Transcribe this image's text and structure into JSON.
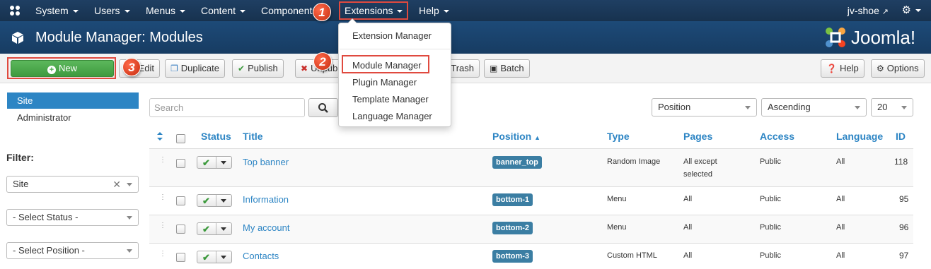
{
  "navbar": {
    "items": [
      {
        "label": "System"
      },
      {
        "label": "Users"
      },
      {
        "label": "Menus"
      },
      {
        "label": "Content"
      },
      {
        "label": "Components"
      },
      {
        "label": "Extensions"
      },
      {
        "label": "Help"
      }
    ],
    "user": "jv-shoe"
  },
  "extensions_menu": {
    "items": [
      "Extension Manager",
      "Module Manager",
      "Plugin Manager",
      "Template Manager",
      "Language Manager"
    ]
  },
  "callouts": [
    "1",
    "2",
    "3"
  ],
  "header": {
    "title": "Module Manager: Modules",
    "brand": "Joomla!"
  },
  "toolbar": {
    "new": "New",
    "edit": "Edit",
    "duplicate": "Duplicate",
    "publish": "Publish",
    "unpublish": "Unpublish",
    "trash": "Trash",
    "batch": "Batch",
    "help": "Help",
    "options": "Options"
  },
  "sidebar": {
    "items": [
      "Site",
      "Administrator"
    ],
    "filter_label": "Filter:",
    "filters": [
      "Site",
      "- Select Status -",
      "- Select Position -"
    ]
  },
  "search": {
    "placeholder": "Search"
  },
  "list_controls": {
    "sort_by": "Position",
    "direction": "Ascending",
    "limit": "20"
  },
  "table": {
    "headers": {
      "status": "Status",
      "title": "Title",
      "position": "Position",
      "type": "Type",
      "pages": "Pages",
      "access": "Access",
      "language": "Language",
      "id": "ID"
    },
    "rows": [
      {
        "title": "Top banner",
        "position": "banner_top",
        "type": "Random Image",
        "pages_line1": "All except",
        "pages_line2": "selected",
        "access": "Public",
        "language": "All",
        "id": "118"
      },
      {
        "title": "Information",
        "position": "bottom-1",
        "type": "Menu",
        "pages_line1": "All",
        "pages_line2": "",
        "access": "Public",
        "language": "All",
        "id": "95"
      },
      {
        "title": "My account",
        "position": "bottom-2",
        "type": "Menu",
        "pages_line1": "All",
        "pages_line2": "",
        "access": "Public",
        "language": "All",
        "id": "96"
      },
      {
        "title": "Contacts",
        "position": "bottom-3",
        "type": "Custom HTML",
        "pages_line1": "All",
        "pages_line2": "",
        "access": "Public",
        "language": "All",
        "id": "97"
      }
    ]
  },
  "colors": {
    "navbar": "#1a3a5c",
    "header": "#1b456f",
    "accent": "#2d85c4",
    "new_button": "#4aa84a",
    "highlight": "#e04a3f"
  }
}
